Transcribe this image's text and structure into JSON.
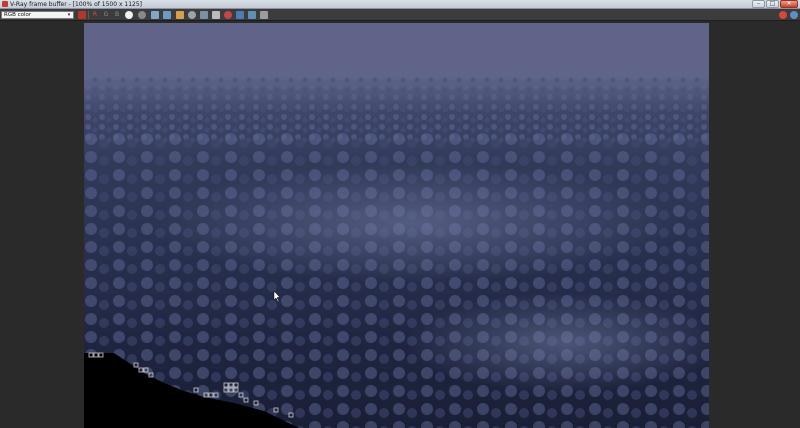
{
  "window": {
    "title": "V-Ray frame buffer - [100% of 1500 x 1125]",
    "min_glyph": "–",
    "max_glyph": "□",
    "close_glyph": "✕"
  },
  "toolbar": {
    "channel_value": "RGB color",
    "channel_arrow": "▾",
    "r_label": "R",
    "g_label": "G",
    "b_label": "B"
  },
  "colors": {
    "accent": "#c63a2b",
    "sky": "#6a6f93",
    "terrain": "#2a3150"
  }
}
